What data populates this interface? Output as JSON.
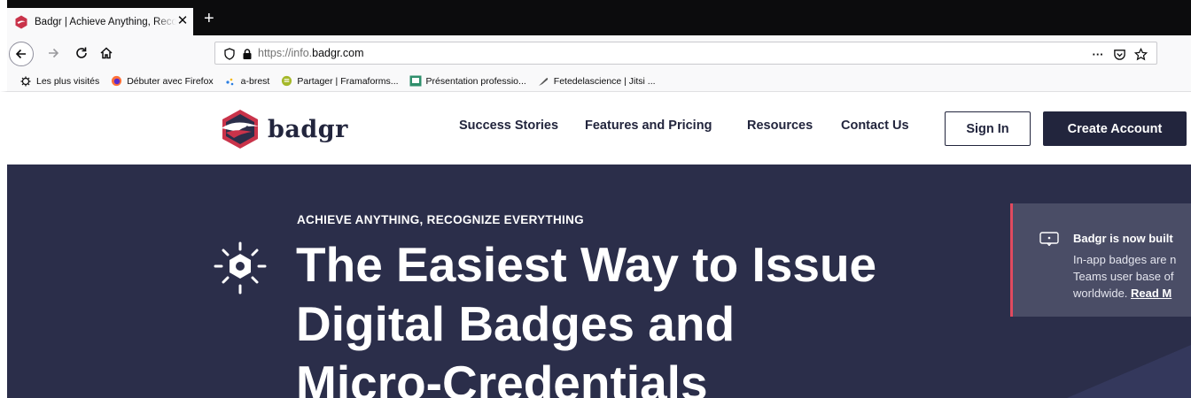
{
  "browser": {
    "tab_title": "Badgr | Achieve Anything, Recognize Everything",
    "close_glyph": "✕",
    "new_tab_glyph": "+",
    "url_prefix": "https://info.",
    "url_domain": "badgr.com",
    "page_actions_glyph": "···",
    "icons": [
      "back-icon",
      "forward-icon",
      "reload-icon",
      "home-icon",
      "shield-icon",
      "lock-icon",
      "pocket-icon",
      "star-icon"
    ]
  },
  "bookmarks": [
    {
      "label": "Les plus visités",
      "icon": "gear-icon"
    },
    {
      "label": "Débuter avec Firefox",
      "icon": "firefox-icon"
    },
    {
      "label": "a-brest",
      "icon": "dots-icon"
    },
    {
      "label": "Partager | Framaforms...",
      "icon": "framaforms-icon"
    },
    {
      "label": "Présentation professio...",
      "icon": "slides-icon"
    },
    {
      "label": "Fetedelascience | Jitsi ...",
      "icon": "feather-icon"
    }
  ],
  "site": {
    "logo_text": "badgr",
    "menu": [
      "Success Stories",
      "Features and Pricing",
      "Resources",
      "Contact Us"
    ],
    "sign_in": "Sign In",
    "create_account": "Create Account"
  },
  "hero": {
    "eyebrow": "ACHIEVE ANYTHING, RECOGNIZE EVERYTHING",
    "headline_lines": [
      "The Easiest Way to Issue",
      "Digital Badges and",
      "Micro-Credentials"
    ],
    "colors": {
      "background": "#2b2e4a",
      "accent": "#e04a5f",
      "brand_dark": "#22253d"
    }
  },
  "notice": {
    "title": "Badgr is now built",
    "body_lines": [
      "In-app badges are n",
      "Teams user base of",
      "worldwide. "
    ],
    "link": "Read M"
  }
}
